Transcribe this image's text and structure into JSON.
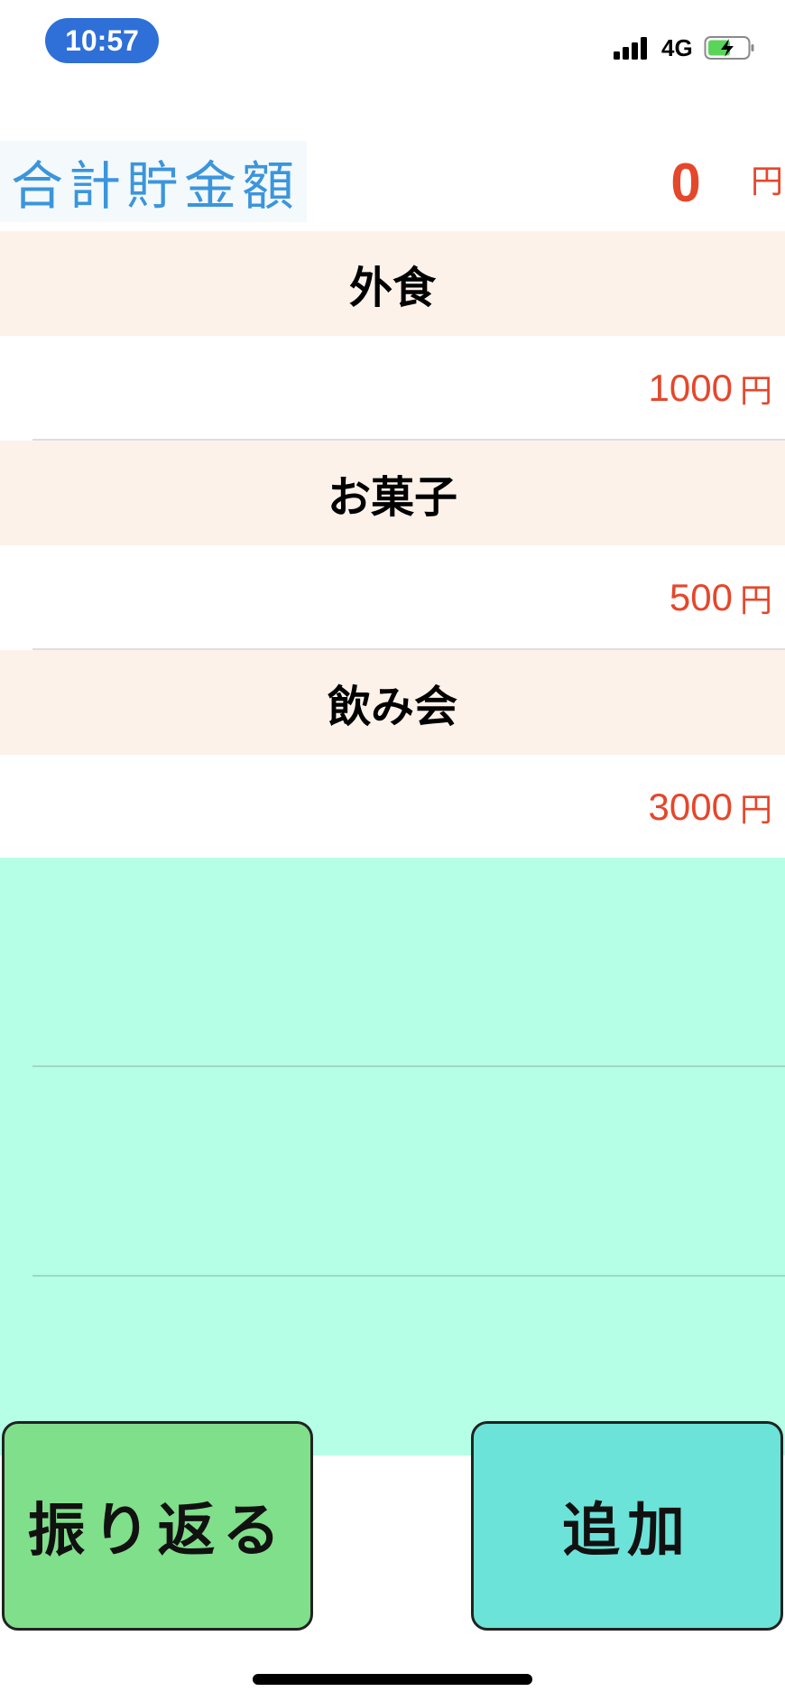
{
  "status_bar": {
    "time": "10:57",
    "network": "4G",
    "icons": [
      "signal-icon",
      "battery-charging-icon"
    ]
  },
  "header": {
    "title": "合計貯金額",
    "total": "0",
    "currency": "円"
  },
  "sections": [
    {
      "title": "外食",
      "amount": "1000",
      "currency": "円"
    },
    {
      "title": "お菓子",
      "amount": "500",
      "currency": "円"
    },
    {
      "title": "飲み会",
      "amount": "3000",
      "currency": "円"
    }
  ],
  "buttons": {
    "review": "振り返る",
    "add": "追加"
  },
  "colors": {
    "accent_red": "#e5472b",
    "title_blue": "#3b95dc",
    "section_bg": "#fdf2ea",
    "empty_bg": "#b5ffe6",
    "review_btn": "#80df8a",
    "add_btn": "#6ce3d8"
  }
}
